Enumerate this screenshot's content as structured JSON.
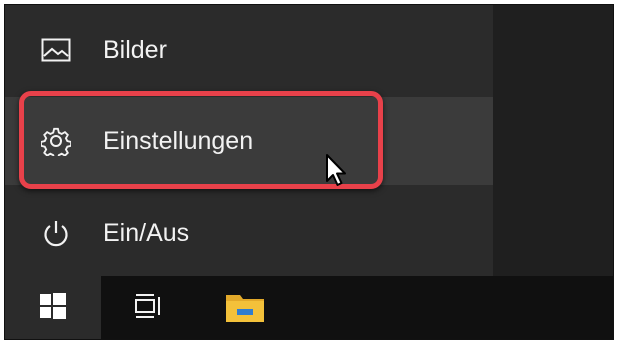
{
  "start_menu": {
    "items": [
      {
        "label": "Bilder",
        "icon": "pictures-icon"
      },
      {
        "label": "Einstellungen",
        "icon": "gear-icon"
      },
      {
        "label": "Ein/Aus",
        "icon": "power-icon"
      }
    ],
    "highlighted_item": "Einstellungen"
  },
  "taskbar": {
    "buttons": [
      {
        "icon": "windows-start-icon"
      },
      {
        "icon": "task-view-icon"
      },
      {
        "icon": "file-explorer-icon"
      }
    ]
  },
  "colors": {
    "menu_bg": "#2b2b2b",
    "hover_bg": "#3b3b3b",
    "taskbar_bg": "#101010",
    "highlight": "#e8414a",
    "folder": "#f3c13a",
    "folder_accent": "#2f7dd1"
  }
}
